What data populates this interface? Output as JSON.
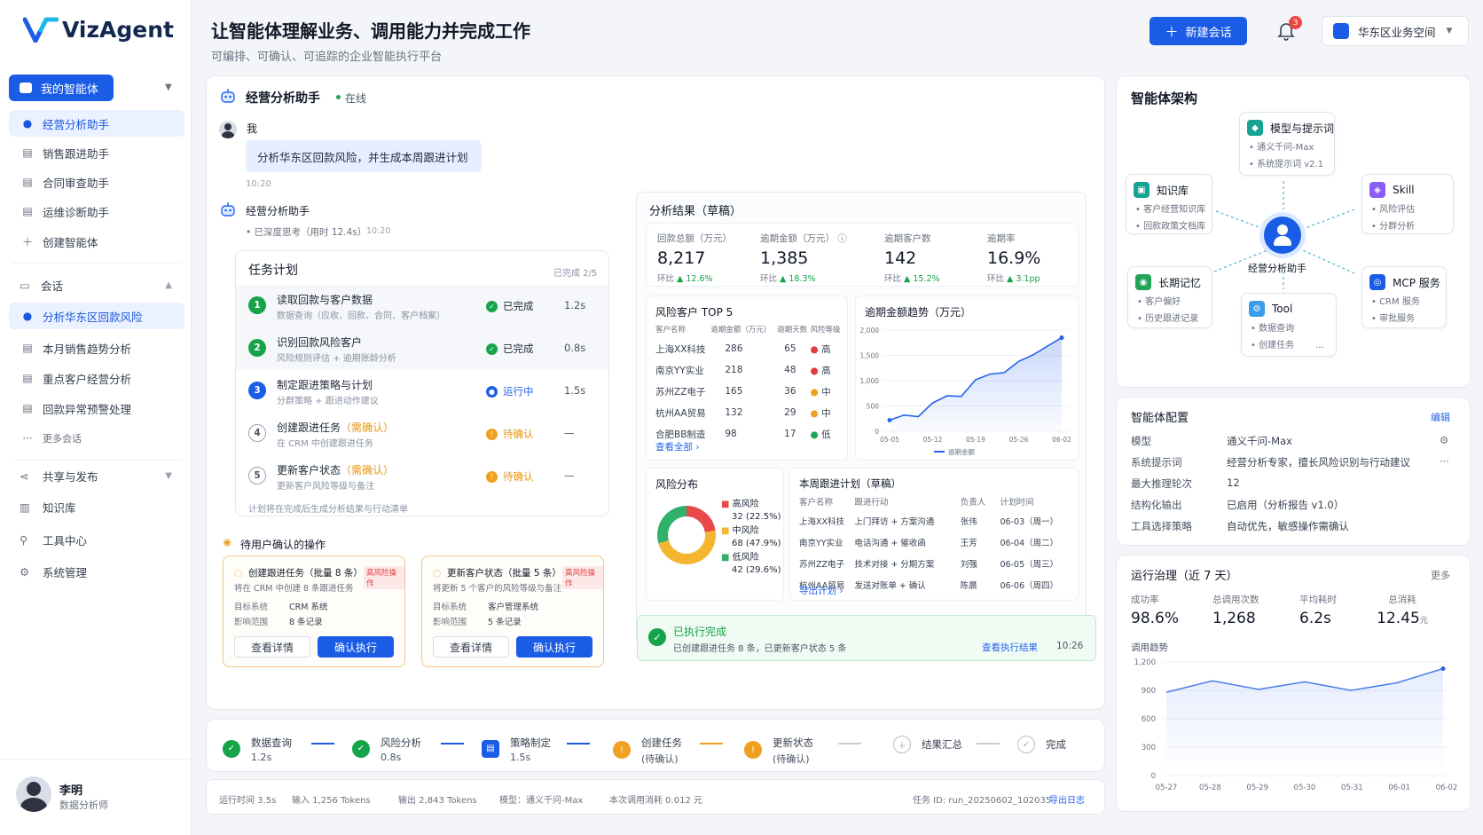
{
  "brand": {
    "name": "VizAgent"
  },
  "header": {
    "title": "让智能体理解业务、调用能力并完成工作",
    "subtitle": "可编排、可确认、可追踪的企业智能执行平台",
    "new_chat": "新建会话",
    "notif_count": "3",
    "workspace": "华东区业务空间"
  },
  "sidebar": {
    "my_agents": "我的智能体",
    "agents": [
      {
        "label": "经营分析助手",
        "active": true
      },
      {
        "label": "销售跟进助手"
      },
      {
        "label": "合同审查助手"
      },
      {
        "label": "运维诊断助手"
      }
    ],
    "create_agent": "创建智能体",
    "sessions_title": "会话",
    "sessions": [
      {
        "label": "分析华东区回款风险",
        "active": true
      },
      {
        "label": "本月销售趋势分析"
      },
      {
        "label": "重点客户经营分析"
      },
      {
        "label": "回款异常预警处理"
      }
    ],
    "more_sessions": "更多会话",
    "nav": [
      "共享与发布",
      "知识库",
      "工具中心",
      "系统管理"
    ],
    "user": {
      "name": "李明",
      "role": "数据分析师"
    }
  },
  "chat": {
    "agent_name": "经营分析助手",
    "status": "在线",
    "user_label": "我",
    "user_msg": "分析华东区回款风险，并生成本周跟进计划",
    "user_time": "10:20",
    "reply_name": "经营分析助手",
    "thinking": "• 已深度思考（用时 12.4s）",
    "thinking_time": "10:20"
  },
  "plan": {
    "title": "任务计划",
    "progress": "已完成 2/5",
    "tasks": [
      {
        "n": "1",
        "title": "读取回款与客户数据",
        "sub": "数据查询（应收、回款、合同、客户档案）",
        "status": "已完成",
        "time": "1.2s",
        "state": "done"
      },
      {
        "n": "2",
        "title": "识别回款风险客户",
        "sub": "风险规则评估 + 逾期账龄分析",
        "status": "已完成",
        "time": "0.8s",
        "state": "done"
      },
      {
        "n": "3",
        "title": "制定跟进策略与计划",
        "sub": "分群策略 + 跟进动作建议",
        "status": "运行中",
        "time": "1.5s",
        "state": "running"
      },
      {
        "n": "4",
        "title": "创建跟进任务",
        "confirm": "（需确认）",
        "sub": "在 CRM 中创建跟进任务",
        "status": "待确认",
        "time": "—",
        "state": "pending"
      },
      {
        "n": "5",
        "title": "更新客户状态",
        "confirm": "（需确认）",
        "sub": "更新客户风险等级与备注",
        "status": "待确认",
        "time": "—",
        "state": "pending"
      }
    ],
    "footnote": "计划将在完成后生成分析结果与行动清单"
  },
  "pending": {
    "title": "待用户确认的操作",
    "cards": [
      {
        "title": "创建跟进任务（批量 8 条）",
        "badge": "高风险操作",
        "desc": "将在 CRM 中创建 8 条跟进任务",
        "k1": "目标系统",
        "v1": "CRM 系统",
        "k2": "影响范围",
        "v2": "8 条记录",
        "detail": "查看详情",
        "confirm": "确认执行"
      },
      {
        "title": "更新客户状态（批量 5 条）",
        "badge": "高风险操作",
        "desc": "将更新 5 个客户的风险等级与备注",
        "k1": "目标系统",
        "v1": "客户管理系统",
        "k2": "影响范围",
        "v2": "5 条记录",
        "detail": "查看详情",
        "confirm": "确认执行"
      }
    ]
  },
  "analysis": {
    "title": "分析结果（草稿）",
    "metrics": [
      {
        "label": "回款总额（万元）",
        "value": "8,217",
        "change_label": "环比",
        "change": "12.6%"
      },
      {
        "label": "逾期金额（万元）",
        "value": "1,385",
        "change_label": "环比",
        "change": "18.3%"
      },
      {
        "label": "逾期客户数",
        "value": "142",
        "change_label": "环比",
        "change": "15.2%"
      },
      {
        "label": "逾期率",
        "value": "16.9%",
        "change_label": "环比",
        "change": "3.1pp"
      }
    ],
    "top5": {
      "title": "风险客户 TOP 5",
      "headers": [
        "客户名称",
        "逾期金额（万元）",
        "逾期天数",
        "风险等级"
      ],
      "rows": [
        {
          "name": "上海XX科技",
          "amount": "286",
          "days": "65",
          "level": "高",
          "color": "#e23b3b"
        },
        {
          "name": "南京YY实业",
          "amount": "218",
          "days": "48",
          "level": "高",
          "color": "#e23b3b"
        },
        {
          "name": "苏州ZZ电子",
          "amount": "165",
          "days": "36",
          "level": "中",
          "color": "#f0a020"
        },
        {
          "name": "杭州AA贸易",
          "amount": "132",
          "days": "29",
          "level": "中",
          "color": "#f0a020"
        },
        {
          "name": "合肥BB制造",
          "amount": "98",
          "days": "17",
          "level": "低",
          "color": "#22a559"
        }
      ],
      "view_all": "查看全部"
    },
    "risk": {
      "title": "风险分布",
      "items": [
        {
          "label": "高风险",
          "value": "32",
          "pct": "(22.5%)",
          "color": "#e84a4a",
          "num": 32
        },
        {
          "label": "中风险",
          "value": "68",
          "pct": "(47.9%)",
          "color": "#f4b630",
          "num": 68
        },
        {
          "label": "低风险",
          "value": "42",
          "pct": "(29.6%)",
          "color": "#31b06a",
          "num": 42
        }
      ]
    },
    "plan_table": {
      "title": "本周跟进计划（草稿）",
      "headers": [
        "客户名称",
        "跟进行动",
        "负责人",
        "计划时间"
      ],
      "rows": [
        [
          "上海XX科技",
          "上门拜访 + 方案沟通",
          "张伟",
          "06-03（周一）"
        ],
        [
          "南京YY实业",
          "电话沟通 + 催收函",
          "王芳",
          "06-04（周二）"
        ],
        [
          "苏州ZZ电子",
          "技术对接 + 分期方案",
          "刘强",
          "06-05（周三）"
        ],
        [
          "杭州AA贸易",
          "发送对账单 + 确认",
          "陈晨",
          "06-06（周四）"
        ]
      ],
      "export": "导出计划"
    },
    "done": {
      "title": "已执行完成",
      "desc": "已创建跟进任务 8 条，已更新客户状态 5 条",
      "link": "查看执行结果",
      "time": "10:26"
    }
  },
  "chart_data": [
    {
      "type": "area",
      "title": "逾期金额趋势（万元）",
      "x": [
        "05-05",
        "05-12",
        "05-19",
        "05-26",
        "06-02"
      ],
      "series": [
        {
          "name": "逾期金额",
          "values": [
            220,
            320,
            290,
            560,
            700,
            690,
            1020,
            1130,
            1160,
            1380,
            1510,
            1680,
            1850
          ]
        }
      ],
      "ylim": [
        0,
        2000
      ],
      "yticks": [
        "2,000",
        "1,500",
        "1,000",
        "500",
        "0"
      ]
    },
    {
      "type": "line",
      "title": "调用趋势",
      "x": [
        "05-27",
        "05-28",
        "05-29",
        "05-30",
        "05-31",
        "06-01",
        "06-02"
      ],
      "series": [
        {
          "name": "调用次数",
          "values": [
            880,
            1000,
            910,
            990,
            900,
            980,
            1130
          ]
        }
      ],
      "ylim": [
        0,
        1200
      ],
      "yticks": [
        "1,200",
        "900",
        "600",
        "300",
        "0"
      ]
    }
  ],
  "flow": {
    "steps": [
      {
        "label": "数据查询",
        "sub": "1.2s",
        "state": "done"
      },
      {
        "label": "风险分析",
        "sub": "0.8s",
        "state": "done"
      },
      {
        "label": "策略制定",
        "sub": "1.5s",
        "state": "running"
      },
      {
        "label": "创建任务",
        "sub": "(待确认)",
        "state": "pending"
      },
      {
        "label": "更新状态",
        "sub": "(待确认)",
        "state": "pending"
      },
      {
        "label": "结果汇总",
        "sub": "",
        "state": "todo"
      },
      {
        "label": "完成",
        "sub": "",
        "state": "todo"
      }
    ]
  },
  "footer": {
    "runtime": "运行时间 3.5s",
    "input": "输入 1,256 Tokens",
    "output": "输出 2,843 Tokens",
    "model": "模型：通义千问-Max",
    "cost": "本次调用消耗 0.012 元",
    "task_id": "任务 ID: run_20250602_102035",
    "export": "导出日志"
  },
  "architecture": {
    "title": "智能体架构",
    "center": "经营分析助手",
    "nodes": {
      "model": {
        "title": "模型与提示词",
        "lines": [
          "• 通义千问-Max",
          "• 系统提示词 v2.1"
        ]
      },
      "kb": {
        "title": "知识库",
        "lines": [
          "• 客户经营知识库",
          "• 回款政策文档库"
        ]
      },
      "skill": {
        "title": "Skill",
        "lines": [
          "• 风险评估",
          "• 分群分析"
        ]
      },
      "memory": {
        "title": "长期记忆",
        "lines": [
          "• 客户偏好",
          "• 历史跟进记录"
        ]
      },
      "tool": {
        "title": "Tool",
        "lines": [
          "• 数据查询",
          "• 创建任务"
        ],
        "more": "..."
      },
      "mcp": {
        "title": "MCP 服务",
        "lines": [
          "• CRM 服务",
          "• 审批服务"
        ]
      }
    }
  },
  "config": {
    "title": "智能体配置",
    "edit": "编辑",
    "rows": [
      {
        "k": "模型",
        "v": "通义千问-Max"
      },
      {
        "k": "系统提示词",
        "v": "经营分析专家，擅长风险识别与行动建议"
      },
      {
        "k": "最大推理轮次",
        "v": "12"
      },
      {
        "k": "结构化输出",
        "v": "已启用（分析报告 v1.0）"
      },
      {
        "k": "工具选择策略",
        "v": "自动优先，敏感操作需确认"
      }
    ]
  },
  "gov": {
    "title": "运行治理（近 7 天）",
    "more": "更多",
    "metrics": [
      {
        "label": "成功率",
        "value": "98.6%"
      },
      {
        "label": "总调用次数",
        "value": "1,268"
      },
      {
        "label": "平均耗时",
        "value": "6.2s"
      },
      {
        "label": "总消耗",
        "value": "12.45",
        "unit": "元"
      }
    ],
    "trend_title": "调用趋势"
  }
}
